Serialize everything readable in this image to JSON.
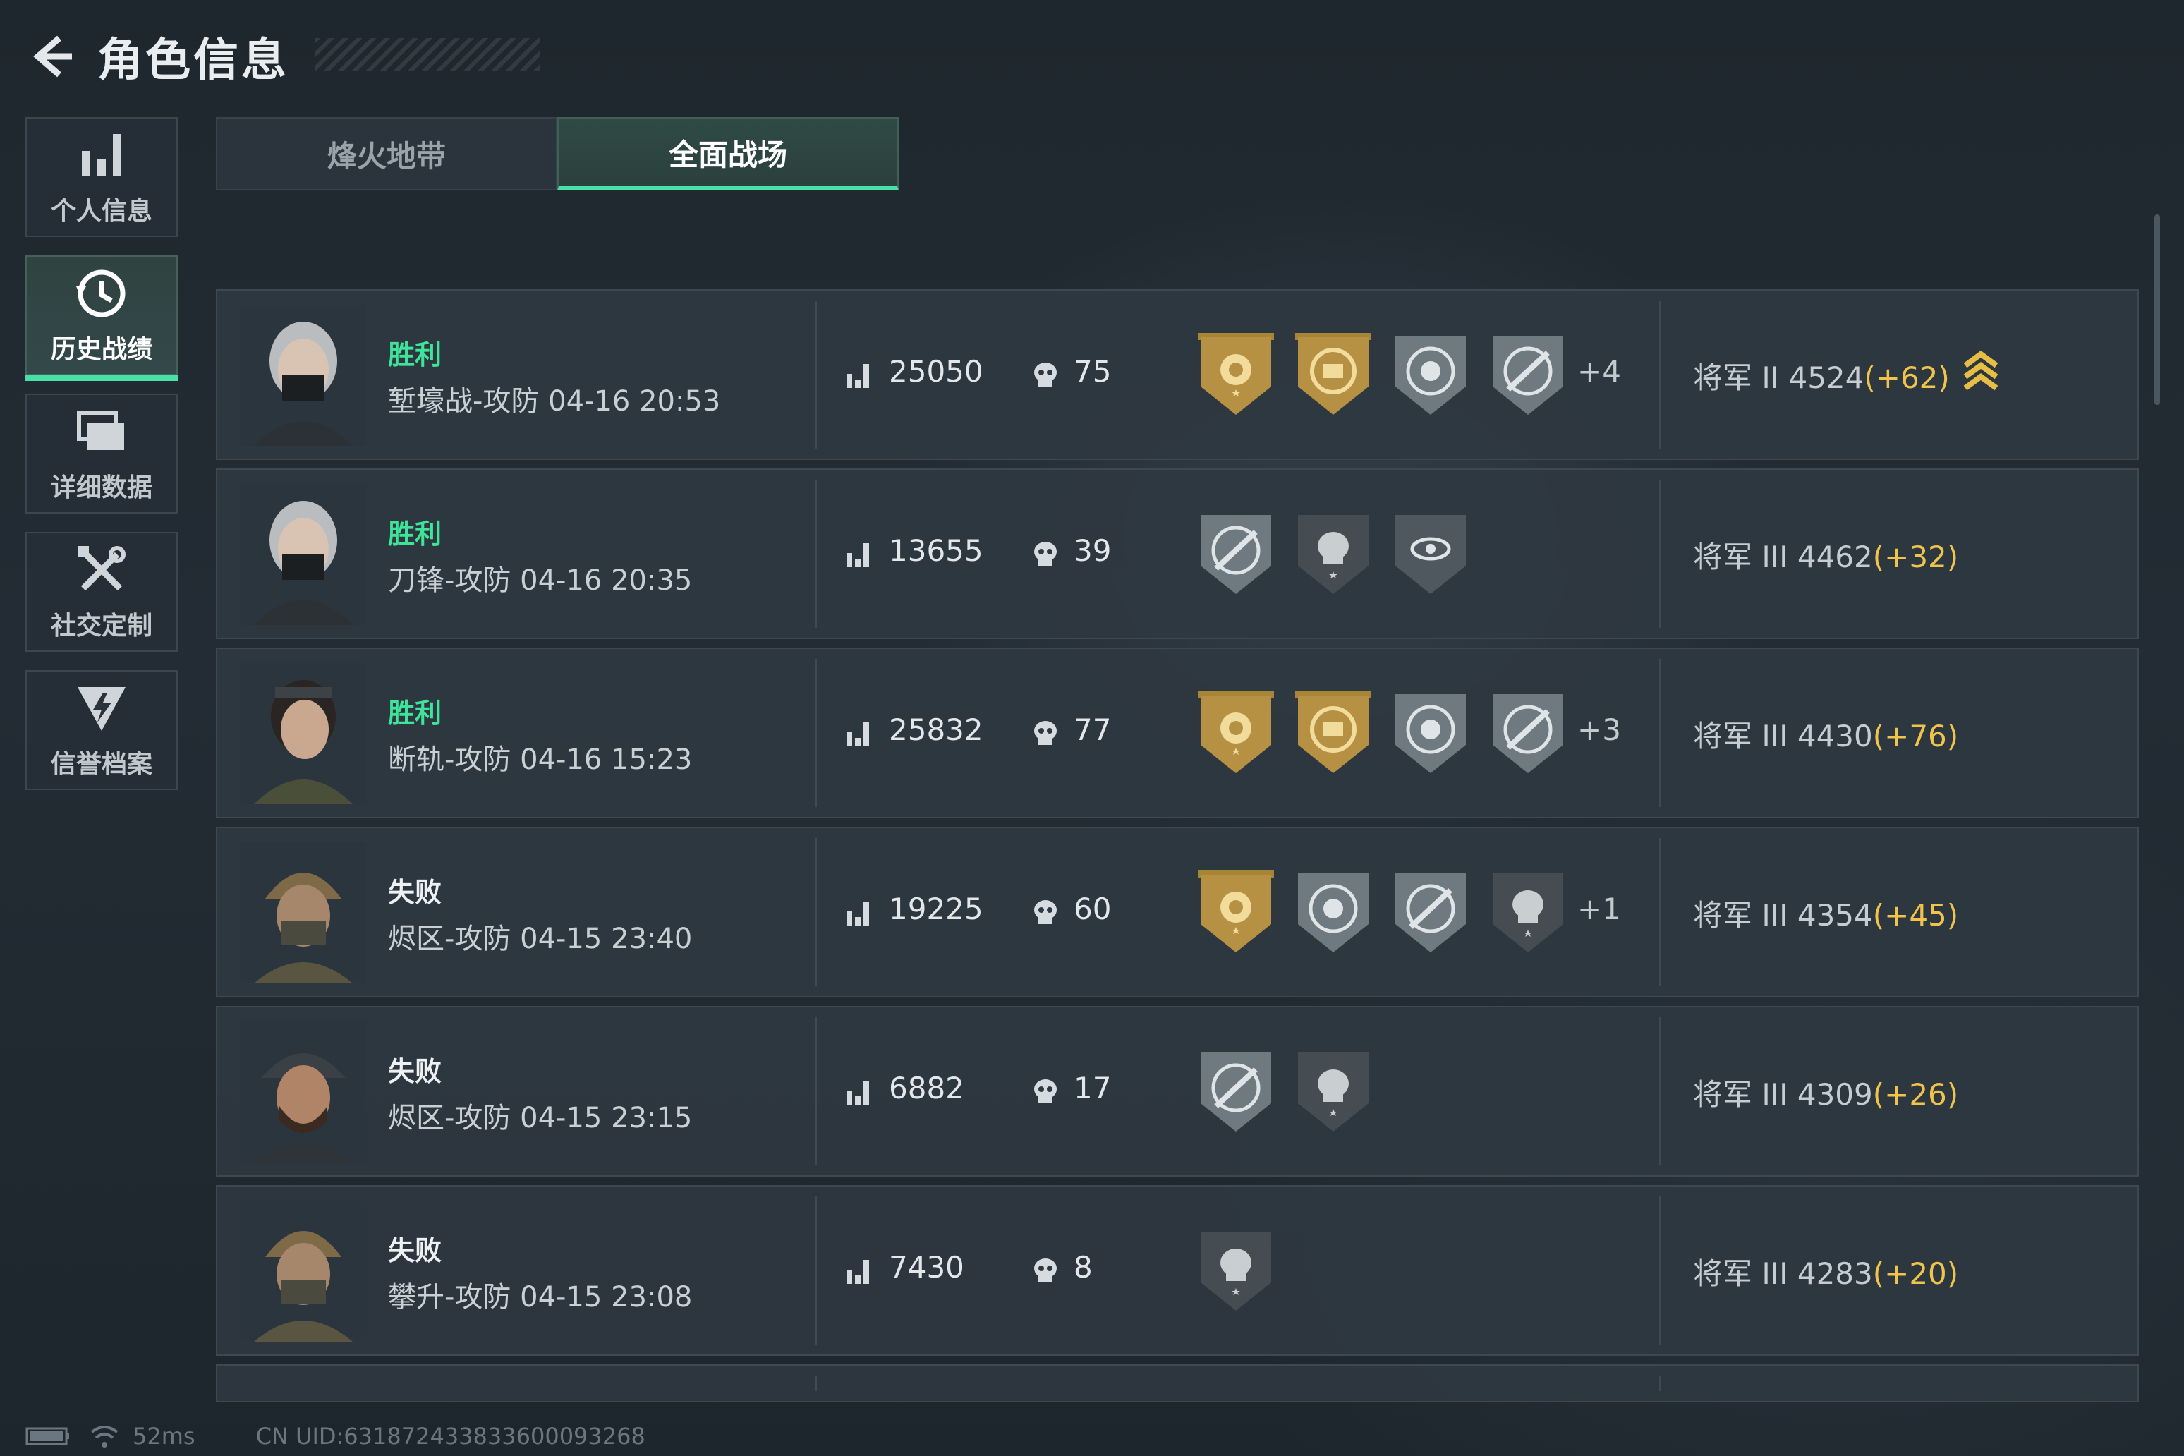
{
  "header": {
    "title": "角色信息"
  },
  "sidebar": {
    "items": [
      {
        "label": "个人信息",
        "icon": "bar-chart-icon",
        "active": false
      },
      {
        "label": "历史战绩",
        "icon": "history-clock-icon",
        "active": true
      },
      {
        "label": "详细数据",
        "icon": "folder-stack-icon",
        "active": false
      },
      {
        "label": "社交定制",
        "icon": "tools-icon",
        "active": false
      },
      {
        "label": "信誉档案",
        "icon": "credit-shield-icon",
        "active": false
      }
    ]
  },
  "tabs": [
    {
      "label": "烽火地带",
      "active": false
    },
    {
      "label": "全面战场",
      "active": true
    }
  ],
  "matches": [
    {
      "result": "胜利",
      "win": true,
      "match": "堑壕战-攻防 04-16 20:53",
      "score": "25050",
      "kills": "75",
      "badges": [
        "gold-rose-badge-icon",
        "gold-emblem-badge-icon",
        "silver-target-badge-icon",
        "silver-rifle-badge-icon"
      ],
      "extra": "+4",
      "rank": "将军 II 4524",
      "delta": "(+62)",
      "rank_up": true
    },
    {
      "result": "胜利",
      "win": true,
      "match": "刀锋-攻防 04-16 20:35",
      "score": "13655",
      "kills": "39",
      "badges": [
        "silver-rifle-badge-icon",
        "dark-skull-badge-icon",
        "silver-eye-badge-icon"
      ],
      "extra": "",
      "rank": "将军 III 4462",
      "delta": "(+32)",
      "rank_up": false
    },
    {
      "result": "胜利",
      "win": true,
      "match": "断轨-攻防 04-16 15:23",
      "score": "25832",
      "kills": "77",
      "badges": [
        "gold-rose-badge-icon",
        "gold-emblem-badge-icon",
        "silver-target-badge-icon",
        "silver-rifle-badge-icon"
      ],
      "extra": "+3",
      "rank": "将军 III 4430",
      "delta": "(+76)",
      "rank_up": false
    },
    {
      "result": "失败",
      "win": false,
      "match": "烬区-攻防 04-15 23:40",
      "score": "19225",
      "kills": "60",
      "badges": [
        "gold-rose-badge-icon",
        "silver-target-badge-icon",
        "silver-rifle-badge-icon",
        "dark-skull-badge-icon"
      ],
      "extra": "+1",
      "rank": "将军 III 4354",
      "delta": "(+45)",
      "rank_up": false
    },
    {
      "result": "失败",
      "win": false,
      "match": "烬区-攻防 04-15 23:15",
      "score": "6882",
      "kills": "17",
      "badges": [
        "silver-rifle-badge-icon",
        "dark-skull-badge-icon"
      ],
      "extra": "",
      "rank": "将军 III 4309",
      "delta": "(+26)",
      "rank_up": false
    },
    {
      "result": "失败",
      "win": false,
      "match": "攀升-攻防 04-15 23:08",
      "score": "7430",
      "kills": "8",
      "badges": [
        "dark-skull-badge-icon"
      ],
      "extra": "",
      "rank": "将军 III 4283",
      "delta": "(+20)",
      "rank_up": false
    }
  ],
  "footer": {
    "ping": "52ms",
    "uid": "CN UID:631872433833600093268"
  },
  "colors": {
    "accent": "#49e0a8",
    "win": "#3fe39a",
    "delta": "#f0c44c",
    "gold": "#c9a24a"
  }
}
